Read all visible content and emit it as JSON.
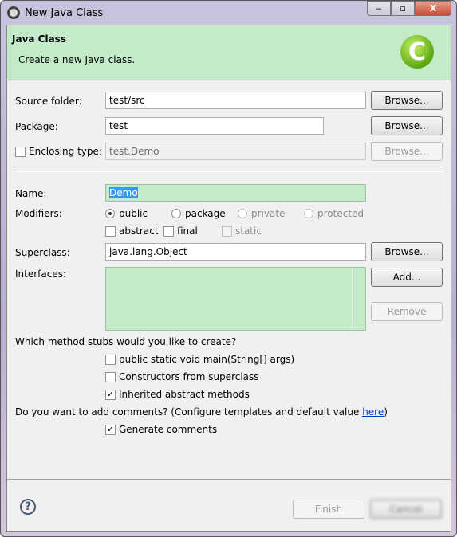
{
  "window": {
    "title": "New Java Class",
    "controls": {
      "minimize": "‒",
      "maximize": "▫",
      "close": "X"
    }
  },
  "banner": {
    "title": "Java Class",
    "description": "Create a new Java class.",
    "icon": "C"
  },
  "form": {
    "source_folder": {
      "label": "Source folder:",
      "value": "test/src",
      "browse": "Browse..."
    },
    "package": {
      "label": "Package:",
      "value": "test",
      "browse": "Browse..."
    },
    "enclosing": {
      "label": "Enclosing type:",
      "value": "test.Demo",
      "checked": false,
      "browse": "Browse..."
    },
    "name": {
      "label": "Name:",
      "value": "Demo"
    },
    "modifiers": {
      "label": "Modifiers:",
      "options": [
        "public",
        "package",
        "private",
        "protected"
      ],
      "selected": "public",
      "extra": [
        "abstract",
        "final",
        "static"
      ]
    },
    "superclass": {
      "label": "Superclass:",
      "value": "java.lang.Object",
      "browse": "Browse..."
    },
    "interfaces": {
      "label": "Interfaces:",
      "add": "Add...",
      "remove": "Remove"
    },
    "stubs": {
      "question": "Which method stubs would you like to create?",
      "items": [
        {
          "label": "public static void main(String[] args)",
          "checked": false
        },
        {
          "label": "Constructors from superclass",
          "checked": false
        },
        {
          "label": "Inherited abstract methods",
          "checked": true
        }
      ]
    },
    "comments": {
      "question": "Do you want to add comments? (Configure templates and default value ",
      "link": "here",
      "close": ")",
      "generate": "Generate comments",
      "checked": true
    }
  },
  "footer": {
    "help": "?",
    "finish": "Finish",
    "cancel": "Cancel"
  },
  "colors": {
    "banner": "#c3ebc9",
    "selection": "#3399ff"
  }
}
